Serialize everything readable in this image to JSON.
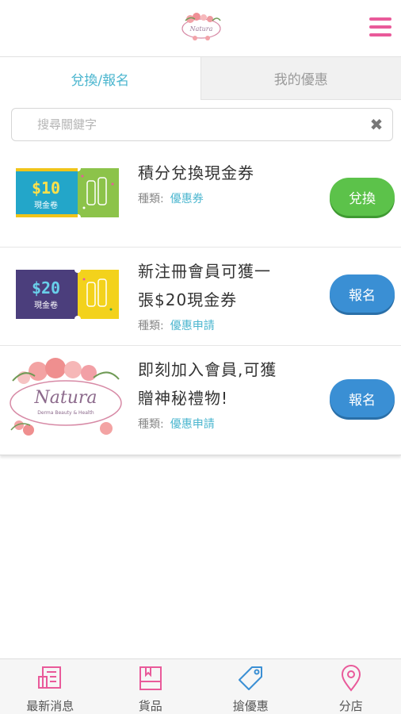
{
  "header": {
    "logo_text": "Natura",
    "menu_icon": "hamburger-icon",
    "accent": "#e95a9a"
  },
  "tabs": [
    {
      "label": "兌換/報名",
      "active": true
    },
    {
      "label": "我的優惠",
      "active": false
    }
  ],
  "search": {
    "placeholder": "搜尋關鍵字",
    "value": "",
    "clear_icon": "clear-icon"
  },
  "items": [
    {
      "title_line1": "積分兌換現金券",
      "title_line2": "",
      "type_label": "種類:",
      "type_value": "優惠券",
      "button": "兌換",
      "thumb_amount": "$10",
      "thumb_sub": "現金卷"
    },
    {
      "title_line1": "新注冊會員可獲一",
      "title_line2": "張$20現金券",
      "type_label": "種類:",
      "type_value": "優惠申請",
      "button": "報名",
      "thumb_amount": "$20",
      "thumb_sub": "現金卷"
    },
    {
      "title_line1": "即刻加入會員,可獲",
      "title_line2": "贈神秘禮物!",
      "type_label": "種類:",
      "type_value": "優惠申請",
      "button": "報名",
      "thumb_brand": "Natura",
      "thumb_sub": "Derma Beauty & Health"
    }
  ],
  "bottom_nav": [
    {
      "label": "最新消息",
      "icon": "news-icon"
    },
    {
      "label": "貨品",
      "icon": "book-icon"
    },
    {
      "label": "搶優惠",
      "icon": "tag-icon"
    },
    {
      "label": "分店",
      "icon": "location-pin-icon"
    }
  ],
  "colors": {
    "tab_active": "#4bb6cf",
    "btn_green": "#5cc24a",
    "btn_blue": "#3a8fd4",
    "nav_pink": "#e95a9a",
    "nav_blue": "#3a8fd4"
  }
}
